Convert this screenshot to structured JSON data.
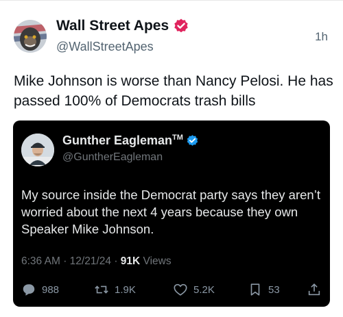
{
  "tweet": {
    "author_name": "Wall Street Apes",
    "handle": "@WallStreetApes",
    "time": "1h",
    "text": "Mike Johnson is worse than Nancy Pelosi. He has passed 100% of Democrats trash bills",
    "verified_color": "#e0245e"
  },
  "quoted": {
    "author_name": "Gunther Eagleman",
    "author_tm": "TM",
    "handle": "@GuntherEagleman",
    "text": "My source inside the Democrat party says they aren’t worried about the next 4 years because they own Speaker Mike Johnson.",
    "time": "6:36 AM",
    "date": "12/21/24",
    "views_count": "91K",
    "views_label": "Views",
    "verified_color": "#1d9bf0",
    "actions": {
      "replies": "988",
      "reposts": "1.9K",
      "likes": "5.2K",
      "bookmarks": "53"
    }
  }
}
